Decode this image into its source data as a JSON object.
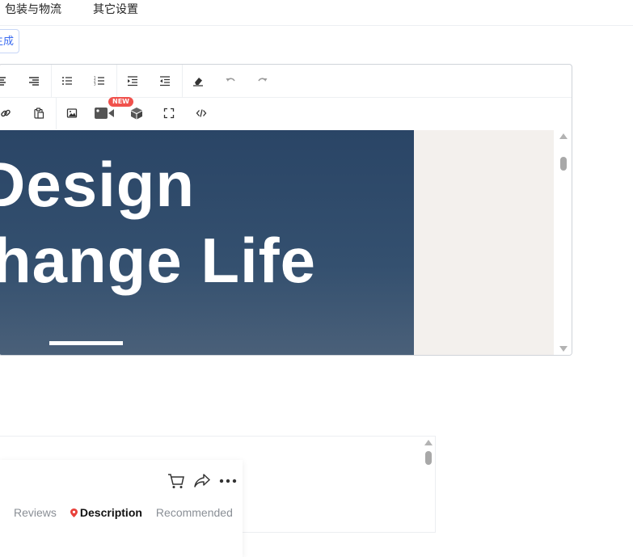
{
  "tabs": [
    "包装与物流",
    "其它设置"
  ],
  "generate_button": "生成",
  "toolbar": {
    "row1": [
      "align-center-icon",
      "align-right-icon",
      "bullet-list-icon",
      "numbered-list-icon",
      "indent-icon",
      "outdent-icon",
      "eraser-icon",
      "undo-icon",
      "redo-icon"
    ],
    "row2": [
      "link-icon",
      "paste-icon",
      "image-icon",
      "video-icon",
      "cube-icon",
      "fullscreen-icon",
      "code-icon"
    ],
    "new_badge": "NEW"
  },
  "banner": {
    "line1": "Design",
    "line2": "hange Life"
  },
  "preview": {
    "tabs": [
      "Reviews",
      "Description",
      "Recommended"
    ],
    "active_tab": "Description"
  },
  "colors": {
    "banner_top": "#2a4566",
    "banner_bottom": "#4a6079",
    "canvas": "#f3f0ed",
    "accent": "#3c6cf0",
    "badge": "#f0514c"
  }
}
